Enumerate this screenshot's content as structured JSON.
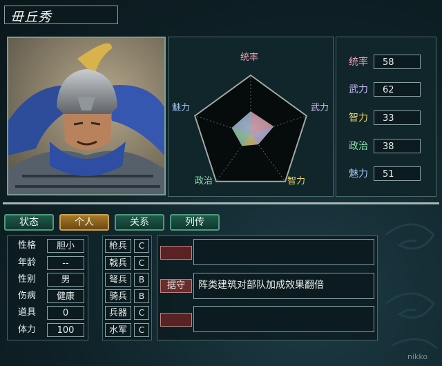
{
  "general_name": "毌丘秀",
  "radar": {
    "labels": [
      "统率",
      "武力",
      "智力",
      "政治",
      "魅力"
    ],
    "colors": [
      "#f2a0b4",
      "#c8b6f2",
      "#e8d46a",
      "#8fe0b0",
      "#9fc4ee"
    ],
    "values": [
      58,
      62,
      33,
      38,
      51
    ]
  },
  "stats": [
    {
      "label": "统率",
      "value": "58",
      "color": "#f2a0b4"
    },
    {
      "label": "武力",
      "value": "62",
      "color": "#c8b6f2"
    },
    {
      "label": "智力",
      "value": "33",
      "color": "#e8d46a"
    },
    {
      "label": "政治",
      "value": "38",
      "color": "#8fe0b0"
    },
    {
      "label": "魅力",
      "value": "51",
      "color": "#9fc4ee"
    }
  ],
  "tabs": [
    {
      "label": "状态",
      "active": false
    },
    {
      "label": "个人",
      "active": true
    },
    {
      "label": "关系",
      "active": false
    },
    {
      "label": "列传",
      "active": false
    }
  ],
  "profile": [
    {
      "label": "性格",
      "value": "胆小"
    },
    {
      "label": "年龄",
      "value": "--"
    },
    {
      "label": "性别",
      "value": "男"
    },
    {
      "label": "伤病",
      "value": "健康"
    },
    {
      "label": "道具",
      "value": "0"
    },
    {
      "label": "体力",
      "value": "100"
    }
  ],
  "skills": [
    {
      "label": "枪兵",
      "grade": "C"
    },
    {
      "label": "戟兵",
      "grade": "C"
    },
    {
      "label": "弩兵",
      "grade": "B"
    },
    {
      "label": "骑兵",
      "grade": "B"
    },
    {
      "label": "兵器",
      "grade": "C"
    },
    {
      "label": "水军",
      "grade": "C"
    }
  ],
  "traits": [
    {
      "name": "",
      "description": ""
    },
    {
      "name": "据守",
      "description": "阵类建筑对部队加成效果翻倍"
    },
    {
      "name": "",
      "description": ""
    }
  ],
  "watermark": "nikko"
}
